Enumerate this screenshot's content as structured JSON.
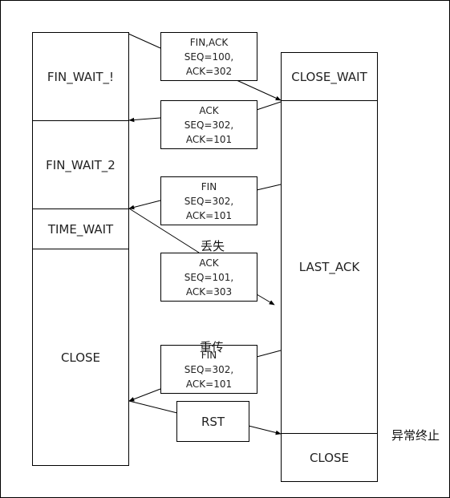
{
  "client_states": [
    "FIN_WAIT_!",
    "FIN_WAIT_2",
    "TIME_WAIT",
    "CLOSE"
  ],
  "server_states": [
    "CLOSE_WAIT",
    "LAST_ACK",
    "CLOSE"
  ],
  "messages": [
    {
      "lines": [
        "FIN,ACK",
        "SEQ=100,",
        "ACK=302"
      ]
    },
    {
      "lines": [
        "ACK",
        "SEQ=302,",
        "ACK=101"
      ]
    },
    {
      "lines": [
        "FIN",
        "SEQ=302,",
        "ACK=101"
      ]
    },
    {
      "lines": [
        "ACK",
        "SEQ=101,",
        "ACK=303"
      ]
    },
    {
      "lines": [
        "FIN",
        "SEQ=302,",
        "ACK=101"
      ]
    }
  ],
  "rst_label": "RST",
  "notes": {
    "lost": "丢失",
    "retransmit": "重传",
    "abnormal_termination": "异常终止"
  }
}
